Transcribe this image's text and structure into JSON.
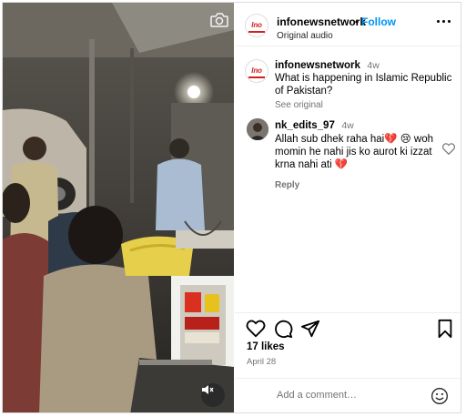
{
  "post": {
    "author": "infonewsnetwork",
    "separator": "•",
    "follow_label": "Follow",
    "audio_label": "Original audio",
    "logo_text": "Ino"
  },
  "caption": {
    "username": "infonewsnetwork",
    "time": "4w",
    "text": "What is happening in Islamic Republic of Pakistan?",
    "see_original": "See original"
  },
  "comments": [
    {
      "username": "nk_edits_97",
      "time": "4w",
      "text": "Allah sub dhek raha hai💔 😢  woh momin he nahi jis ko aurot ki izzat krna nahi ati 💔",
      "reply_label": "Reply"
    }
  ],
  "stats": {
    "likes": "17 likes",
    "date": "April 28"
  },
  "comment_box": {
    "placeholder": "Add a comment…"
  },
  "icons": {
    "camera": "camera-icon",
    "muted": "speaker-muted-icon",
    "more": "more-options-icon",
    "like": "heart-icon",
    "comment": "comment-bubble-icon",
    "share": "paper-plane-icon",
    "save": "bookmark-icon",
    "emoji": "emoji-icon"
  },
  "colors": {
    "accent": "#0095f6",
    "brand": "#d21f1f",
    "muted_text": "#737373",
    "border": "#dbdbdb"
  }
}
